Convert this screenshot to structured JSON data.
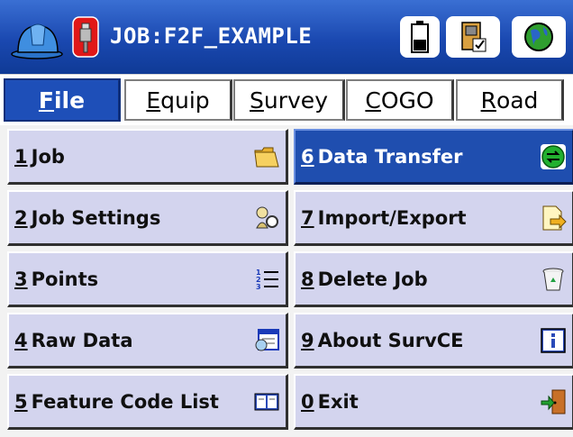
{
  "titlebar": {
    "job_title": "JOB:F2F_EXAMPLE",
    "icons": [
      "hard-hat-icon",
      "gps-rover-icon",
      "battery-icon",
      "instrument-status-icon",
      "globe-icon"
    ]
  },
  "tabs": [
    {
      "key": "F",
      "rest": "ile",
      "active": true
    },
    {
      "key": "E",
      "rest": "quip",
      "active": false
    },
    {
      "key": "S",
      "rest": "urvey",
      "active": false
    },
    {
      "key": "C",
      "rest": "OGO",
      "active": false
    },
    {
      "key": "R",
      "rest": "oad",
      "active": false
    }
  ],
  "menu": {
    "left": [
      {
        "num": "1",
        "label": "Job",
        "icon": "folder-open-icon"
      },
      {
        "num": "2",
        "label": "Job Settings",
        "icon": "settings-person-icon"
      },
      {
        "num": "3",
        "label": "Points",
        "icon": "numbered-list-icon"
      },
      {
        "num": "4",
        "label": "Raw Data",
        "icon": "data-window-icon"
      },
      {
        "num": "5",
        "label": "Feature Code List",
        "icon": "book-icon"
      }
    ],
    "right": [
      {
        "num": "6",
        "label": "Data Transfer",
        "icon": "transfer-icon",
        "selected": true
      },
      {
        "num": "7",
        "label": "Import/Export",
        "icon": "document-export-icon"
      },
      {
        "num": "8",
        "label": "Delete Job",
        "icon": "recycle-bin-icon"
      },
      {
        "num": "9",
        "label": "About SurvCE",
        "icon": "info-icon"
      },
      {
        "num": "0",
        "label": "Exit",
        "icon": "exit-door-icon"
      }
    ]
  },
  "colors": {
    "titlebar": "#1a48b0",
    "active_tab": "#1e4fb8",
    "menu_button": "#d3d4ee",
    "menu_selected": "#1f4eaf"
  }
}
